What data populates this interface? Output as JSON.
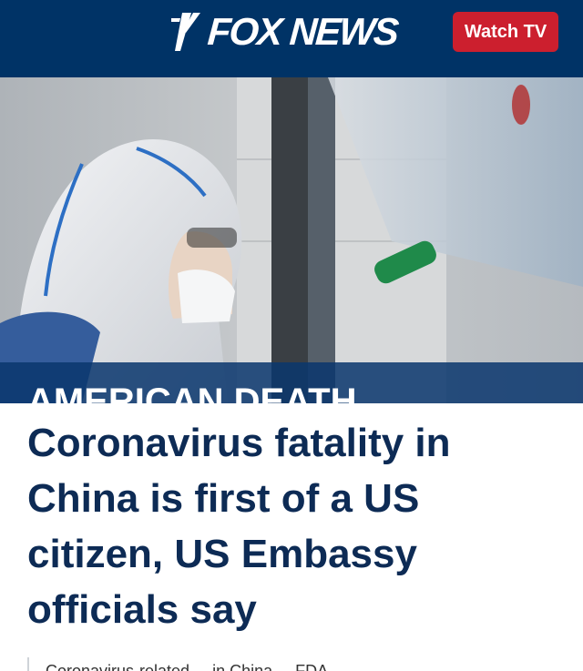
{
  "header": {
    "logo_text": "FOX NEWS",
    "watch_button_label": "Watch TV",
    "background_color": "#003366",
    "button_color": "#cc1f2e"
  },
  "hero": {
    "image_description_icon": "lab-scientist-hazmat-photo",
    "banner_text": "AMERICAN DEATH REPORTED"
  },
  "article": {
    "headline": "Coronavirus fatality in China is first of a US citizen, US Embassy officials say",
    "headline_color": "#0d2b55",
    "snippet_text": "Coronavirus-related ... in China ... FDA"
  }
}
